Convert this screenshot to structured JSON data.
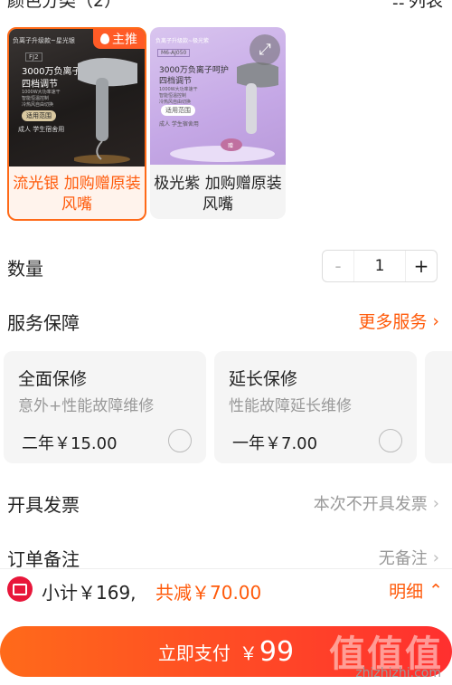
{
  "header": {
    "title": "颜色分类（2）",
    "view_toggle": "列表"
  },
  "colors": [
    {
      "name": "流光银 加购赠原装风嘴",
      "selected": true,
      "badge": "主推",
      "image": {
        "top_tag": "负离子升级款~星光银",
        "model": "FJ2",
        "headline1": "3000万负离子呵护",
        "headline2": "四档调节",
        "bullets": [
          "1000W大功率速干",
          "智能恒温控制",
          "冷热风自由切换"
        ],
        "pill": "适用范围",
        "footer": "成人 学生宿舍用"
      }
    },
    {
      "name": "极光紫 加购赠原装风嘴",
      "selected": false,
      "image": {
        "top_tag": "负离子升级款~极光紫",
        "model": "M6-AJ050",
        "headline1": "3000万负离子呵护",
        "headline2": "四档调节",
        "bullets": [
          "1000W大功率速干",
          "智能恒温控制",
          "冷热风自由切换"
        ],
        "pill": "适用范围",
        "footer": "成人 学生宿舍用",
        "nozzle_label": "赠"
      }
    }
  ],
  "quantity": {
    "label": "数量",
    "minus": "-",
    "value": "1",
    "plus": "+"
  },
  "service": {
    "label": "服务保障",
    "more": "更多服务",
    "cards": [
      {
        "title": "全面保修",
        "desc": "意外+性能故障维修",
        "price": "二年￥15.00"
      },
      {
        "title": "延长保修",
        "desc": "性能故障延长维修",
        "price": "一年￥7.00"
      }
    ]
  },
  "invoice": {
    "label": "开具发票",
    "value": "本次不开具发票"
  },
  "remark": {
    "label": "订单备注",
    "value": "无备注"
  },
  "summary": {
    "subtotal": "小计￥169,",
    "discount": "共减￥70.00",
    "detail": "明细"
  },
  "pay": {
    "label": "立即支付",
    "currency": "￥",
    "amount": "99"
  },
  "watermark": {
    "text": "值值值",
    "url": "zhizhizhi.com"
  },
  "colors_theme": {
    "accent": "#ff5a0a",
    "pay_gradient_start": "#ff6a1a",
    "pay_gradient_end": "#ff2f2f"
  }
}
